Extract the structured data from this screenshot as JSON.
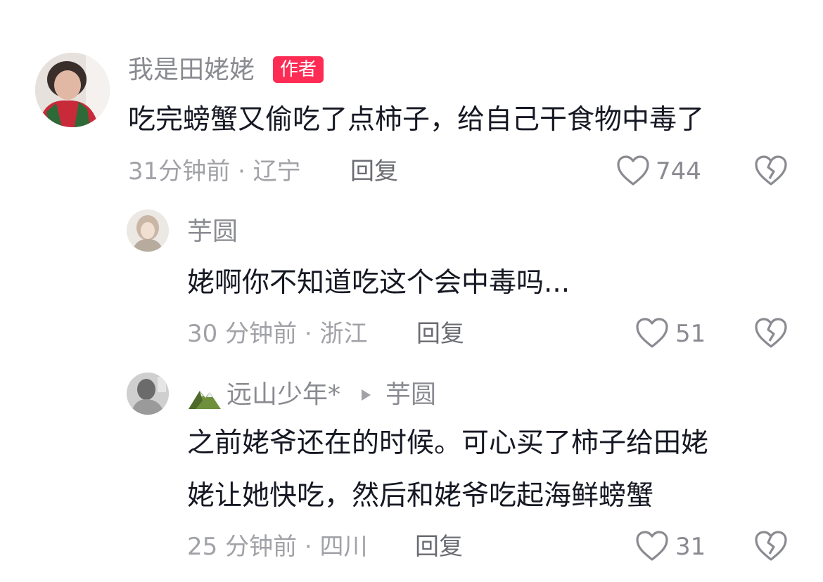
{
  "comments": [
    {
      "username": "我是田姥姥",
      "badge": "作者",
      "text": "吃完螃蟹又偷吃了点柿子，给自己干食物中毒了",
      "time_location": "31分钟前 · 辽宁",
      "reply_label": "回复",
      "likes": "744",
      "like_icon": "heart-outline-icon",
      "dislike_icon": "broken-heart-icon"
    },
    {
      "username": "芋圆",
      "text": "姥啊你不知道吃这个会中毒吗...",
      "time_location": "30 分钟前 · 浙江",
      "reply_label": "回复",
      "likes": "51"
    },
    {
      "username": "远山少年*",
      "reply_to": "芋圆",
      "text_line1": "之前姥爷还在的时候。可心买了柿子给田姥",
      "text_line2": "姥让她快吃，然后和姥爷吃起海鲜螃蟹",
      "time_location": "25 分钟前 · 四川",
      "reply_label": "回复",
      "likes": "31"
    }
  ],
  "colors": {
    "badge": "#fe2c55",
    "text": "#161823",
    "secondary": "#a1a2a7"
  }
}
